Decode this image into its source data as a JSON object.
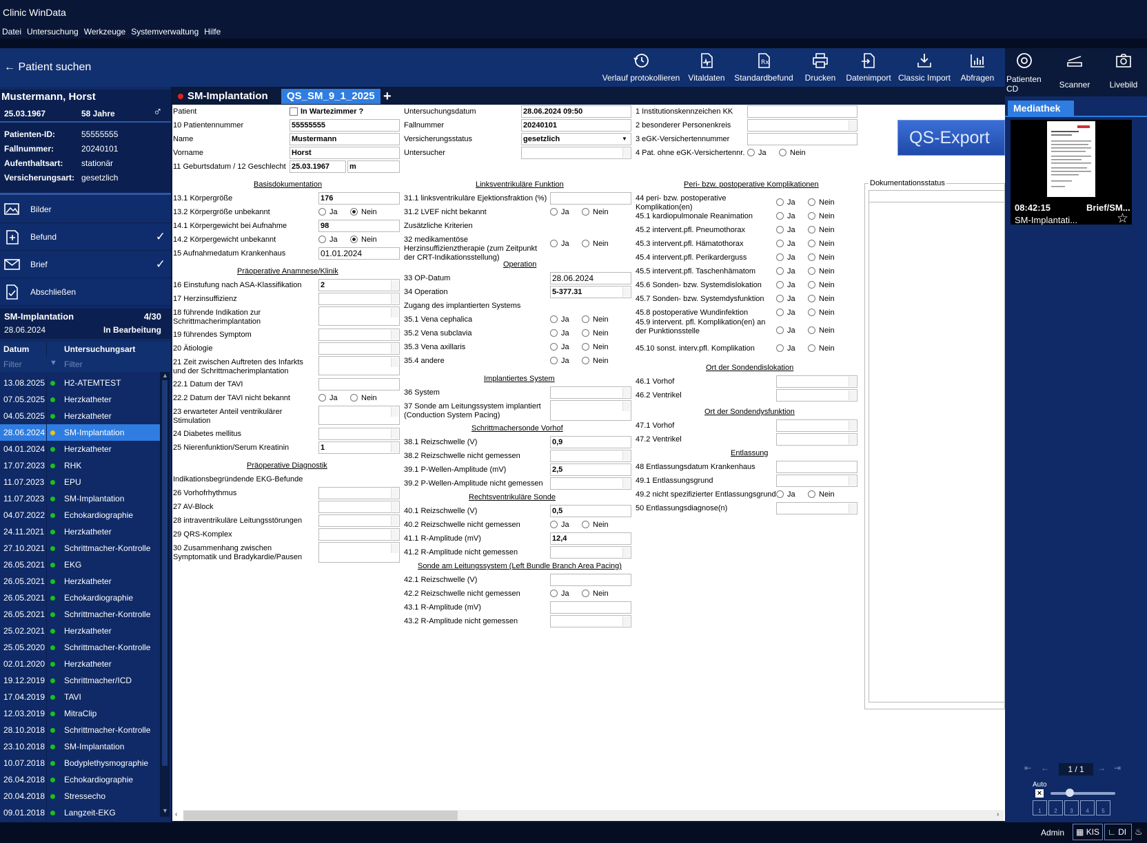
{
  "window": {
    "title": "Clinic WinData"
  },
  "menu": [
    "Datei",
    "Untersuchung",
    "Werkzeuge",
    "Systemverwaltung",
    "Hilfe"
  ],
  "left": {
    "search": "Patient suchen",
    "patient": {
      "name": "Mustermann, Horst",
      "dob": "25.03.1967",
      "age": "58 Jahre",
      "fields": [
        {
          "label": "Patienten-ID:",
          "value": "55555555"
        },
        {
          "label": "Fallnummer:",
          "value": "20240101"
        },
        {
          "label": "Aufenthaltsart:",
          "value": "stationär"
        },
        {
          "label": "Versicherungsart:",
          "value": "gesetzlich"
        }
      ]
    },
    "nav": [
      {
        "label": "Bilder",
        "icon": "image-icon",
        "checked": false
      },
      {
        "label": "Befund",
        "icon": "document-add-icon",
        "checked": true
      },
      {
        "label": "Brief",
        "icon": "mail-icon",
        "checked": true
      },
      {
        "label": "Abschließen",
        "icon": "document-check-icon",
        "checked": false
      }
    ],
    "exam": {
      "title": "SM-Implantation",
      "count": "4/30",
      "date": "28.06.2024",
      "status": "In Bearbeitung"
    },
    "table": {
      "col_date": "Datum",
      "col_type": "Untersuchungsart",
      "filter": "Filter",
      "rows": [
        {
          "date": "13.08.2025",
          "type": "H2-ATEMTEST"
        },
        {
          "date": "07.05.2025",
          "type": "Herzkatheter"
        },
        {
          "date": "04.05.2025",
          "type": "Herzkatheter"
        },
        {
          "date": "28.06.2024",
          "type": "SM-Implantation",
          "selected": true
        },
        {
          "date": "04.01.2024",
          "type": "Herzkatheter"
        },
        {
          "date": "17.07.2023",
          "type": "RHK"
        },
        {
          "date": "11.07.2023",
          "type": "EPU"
        },
        {
          "date": "11.07.2023",
          "type": "SM-Implantation"
        },
        {
          "date": "04.07.2022",
          "type": "Echokardiographie"
        },
        {
          "date": "24.11.2021",
          "type": "Herzkatheter"
        },
        {
          "date": "27.10.2021",
          "type": "Schrittmacher-Kontrolle"
        },
        {
          "date": "26.05.2021",
          "type": "EKG"
        },
        {
          "date": "26.05.2021",
          "type": "Herzkatheter"
        },
        {
          "date": "26.05.2021",
          "type": "Echokardiographie"
        },
        {
          "date": "26.05.2021",
          "type": "Schrittmacher-Kontrolle"
        },
        {
          "date": "25.02.2021",
          "type": "Herzkatheter"
        },
        {
          "date": "25.05.2020",
          "type": "Schrittmacher-Kontrolle"
        },
        {
          "date": "02.01.2020",
          "type": "Herzkatheter"
        },
        {
          "date": "19.12.2019",
          "type": "Schrittmacher/ICD"
        },
        {
          "date": "17.04.2019",
          "type": "TAVI"
        },
        {
          "date": "12.03.2019",
          "type": "MitraClip"
        },
        {
          "date": "28.10.2018",
          "type": "Schrittmacher-Kontrolle"
        },
        {
          "date": "23.10.2018",
          "type": "SM-Implantation"
        },
        {
          "date": "10.07.2018",
          "type": "Bodyplethysmographie"
        },
        {
          "date": "26.04.2018",
          "type": "Echokardiographie"
        },
        {
          "date": "20.04.2018",
          "type": "Stressecho"
        },
        {
          "date": "09.01.2018",
          "type": "Langzeit-EKG"
        }
      ]
    }
  },
  "toolbar": [
    {
      "label": "Verlauf protokollieren",
      "icon": "history-icon"
    },
    {
      "label": "Vitaldaten",
      "icon": "vitals-icon"
    },
    {
      "label": "Standardbefund",
      "icon": "prescription-icon"
    },
    {
      "label": "Drucken",
      "icon": "printer-icon"
    },
    {
      "label": "Datenimport",
      "icon": "import-icon"
    },
    {
      "label": "Classic Import",
      "icon": "download-tray-icon"
    },
    {
      "label": "Abfragen",
      "icon": "bar-chart-icon"
    }
  ],
  "right_toolbar": [
    {
      "label": "Patienten CD",
      "icon": "disc-icon"
    },
    {
      "label": "Scanner",
      "icon": "scanner-icon"
    },
    {
      "label": "Livebild",
      "icon": "camera-icon"
    }
  ],
  "tabs": {
    "active": "SM-Implantation",
    "second": "QS_SM_9_1_2025",
    "add": "+"
  },
  "qs_export": "QS-Export",
  "doc_status": "Dokumentationsstatus",
  "media": {
    "tab": "Mediathek",
    "time": "08:42:15",
    "type": "Brief/SM...",
    "name": "SM-Implantati...",
    "page": "1 / 1",
    "auto": "Auto",
    "slots": [
      "1",
      "2",
      "3",
      "4",
      "5"
    ]
  },
  "status": {
    "user": "Admin",
    "kis": "KIS",
    "di": "DI"
  },
  "form": {
    "c1": {
      "patient": "Patient",
      "wartezimmer": "In Wartezimmer ?",
      "l10": "10 Patientennummer",
      "v10": "55555555",
      "lname": "Name",
      "vname": "Mustermann",
      "lvor": "Vorname",
      "vvor": "Horst",
      "l11": "11 Geburtsdatum / 12 Geschlecht",
      "v11": "25.03.1967",
      "v12": "m",
      "sec_basis": "Basisdokumentation",
      "l131": "13.1 Körpergröße",
      "v131": "176",
      "l132": "13.2 Körpergröße unbekannt",
      "l141": "14.1 Körpergewicht bei Aufnahme",
      "v141": "98",
      "l142": "14.2 Körpergewicht unbekannt",
      "l15": "15 Aufnahmedatum Krankenhaus",
      "v15": "01.01.2024",
      "sec_praeop": "Präoperative Anamnese/Klinik",
      "l16": "16 Einstufung nach ASA-Klassifikation",
      "v16": "2",
      "l17": "17 Herzinsuffizienz",
      "l18": "18 führende Indikation zur Schrittmacherimplantation",
      "l19": "19 führendes Symptom",
      "l20": "20 Ätiologie",
      "l21": "21 Zeit zwischen Auftreten des Infarkts und der Schrittmacherimplantation",
      "l221": "22.1 Datum der TAVI",
      "l222": "22.2 Datum der TAVI nicht bekannt",
      "l23": "23 erwarteter Anteil ventrikulärer Stimulation",
      "l24": "24 Diabetes mellitus",
      "l25": "25 Nierenfunktion/Serum Kreatinin",
      "v25": "1",
      "sec_diag": "Präoperative Diagnostik",
      "lekg": "Indikationsbegründende EKG-Befunde",
      "l26": "26 Vorhofrhythmus",
      "l27": "27 AV-Block",
      "l28": "28 intraventrikuläre Leitungsstörungen",
      "l29": "29 QRS-Komplex",
      "l30": "30 Zusammenhang zwischen Symptomatik und Bradykardie/Pausen"
    },
    "c2": {
      "ldate": "Untersuchungsdatum",
      "vdate": "28.06.2024 09:50",
      "lfall": "Fallnummer",
      "vfall": "20240101",
      "lvers": "Versicherungsstatus",
      "vvers": "gesetzlich",
      "lunt": "Untersucher",
      "sec_lv": "Linksventrikuläre Funktion",
      "l311": "31.1 linksventrikuläre Ejektionsfraktion (%)",
      "l312": "31.2 LVEF nicht bekannt",
      "lzus": "Zusätzliche Kriterien",
      "l32": "32 medikamentöse Herzinsuffizienztherapie (zum Zeitpunkt der CRT-Indikationsstellung)",
      "sec_op": "Operation",
      "l33": "33 OP-Datum",
      "v33": "28.06.2024",
      "l34": "34 Operation",
      "v34": "5-377.31",
      "lzug": "Zugang des implantierten Systems",
      "l351": "35.1 Vena cephalica",
      "l352": "35.2 Vena subclavia",
      "l353": "35.3 Vena axillaris",
      "l354": "35.4 andere",
      "sec_impl": "Implantiertes System",
      "l36": "36 System",
      "l37": "37 Sonde am Leitungssystem implantiert (Conduction System Pacing)",
      "sec_vorhof": "Schrittmachersonde Vorhof",
      "l381": "38.1 Reizschwelle (V)",
      "v381": "0,9",
      "l382": "38.2 Reizschwelle nicht gemessen",
      "l391": "39.1 P-Wellen-Amplitude (mV)",
      "v391": "2,5",
      "l392": "39.2 P-Wellen-Amplitude nicht gemessen",
      "sec_rv": "Rechtsventrikuläre Sonde",
      "l401": "40.1 Reizschwelle (V)",
      "v401": "0,5",
      "l402": "40.2 Reizschwelle nicht gemessen",
      "l411": "41.1 R-Amplitude (mV)",
      "v411": "12,4",
      "l412": "41.2 R-Amplitude nicht gemessen",
      "sec_lbb": "Sonde am Leitungssystem (Left Bundle Branch Area Pacing)",
      "l421": "42.1 Reizschwelle (V)",
      "l422": "42.2 Reizschwelle nicht gemessen",
      "l431": "43.1 R-Amplitude (mV)",
      "l432": "43.2 R-Amplitude nicht gemessen"
    },
    "c3": {
      "l1": "1 Institutionskennzeichen KK",
      "l2": "2 besonderer Personenkreis",
      "l3": "3 eGK-Versichertennummer",
      "l4": "4 Pat. ohne eGK-Versichertennr.",
      "sec_kompl": "Peri- bzw. postoperative Komplikationen",
      "l44": "44 peri- bzw. postoperative Komplikation(en)",
      "l451": "45.1 kardiopulmonale Reanimation",
      "l452": "45.2 intervent.pfl. Pneumothorax",
      "l453": "45.3 intervent.pfl. Hämatothorax",
      "l454": "45.4 intervent.pfl. Perikarderguss",
      "l455": "45.5 intervent.pfl. Taschenhämatom",
      "l456": "45.6 Sonden- bzw. Systemdislokation",
      "l457": "45.7 Sonden- bzw. Systemdysfunktion",
      "l458": "45.8 postoperative Wundinfektion",
      "l459": "45.9 intervent. pfl. Komplikation(en) an der Punktionsstelle",
      "l4510": "45.10 sonst. interv.pfl. Komplikation",
      "sec_disl": "Ort der Sondendislokation",
      "l461": "46.1 Vorhof",
      "l462": "46.2 Ventrikel",
      "sec_dysf": "Ort der Sondendysfunktion",
      "l471": "47.1 Vorhof",
      "l472": "47.2 Ventrikel",
      "sec_entl": "Entlassung",
      "l48": "48 Entlassungsdatum Krankenhaus",
      "l491": "49.1 Entlassungsgrund",
      "l492": "49.2 nicht spezifizierter Entlassungsgrund",
      "l50": "50 Entlassungsdiagnose(n)"
    },
    "ja": "Ja",
    "nein": "Nein"
  },
  "colors": {
    "accent": "#2f7de0",
    "panel": "#0f2a66",
    "dark": "#0b1a3a",
    "green": "#19c219",
    "selected_dot": "#e8c31a",
    "red": "#e02020"
  }
}
